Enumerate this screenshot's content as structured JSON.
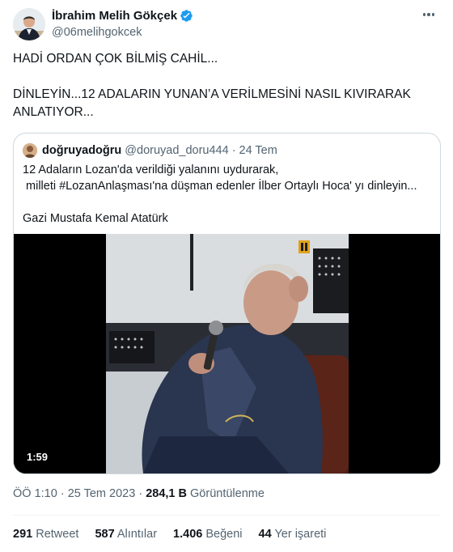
{
  "author": {
    "name": "İbrahim Melih Gökçek",
    "handle": "@06melihgokcek",
    "verified_color": "#1d9bf0"
  },
  "tweet": {
    "line1": "HADİ ORDAN ÇOK BİLMİŞ CAHİL...",
    "line2": "DİNLEYİN...12 ADALARIN YUNAN’A VERİLMESİNİ NASIL KIVIRARAK ANLATIYOR..."
  },
  "quote": {
    "name": "doğruyadoğru",
    "handle": "@doruyad_doru444",
    "separator": "·",
    "date": "24 Tem",
    "text_line1": "12 Adaların Lozan'da verildiği yalanını uydurarak,",
    "text_line2": " milleti #LozanAnlaşması'na düşman edenler İlber Ortaylı Hoca' yı dinleyin...",
    "text_line3": "Gazi Mustafa Kemal Atatürk",
    "video_duration": "1:59"
  },
  "meta": {
    "time": "ÖÖ 1:10",
    "separator": "·",
    "date": "25 Tem 2023",
    "views_count": "284,1 B",
    "views_label": "Görüntülenme"
  },
  "stats": [
    {
      "count": "291",
      "label": "Retweet"
    },
    {
      "count": "587",
      "label": "Alıntılar"
    },
    {
      "count": "1.406",
      "label": "Beğeni"
    },
    {
      "count": "44",
      "label": "Yer işareti"
    }
  ],
  "icons": {
    "verified": "verified-badge-icon",
    "more": "more-options-icon",
    "video_logo": "channel-logo-icon"
  }
}
